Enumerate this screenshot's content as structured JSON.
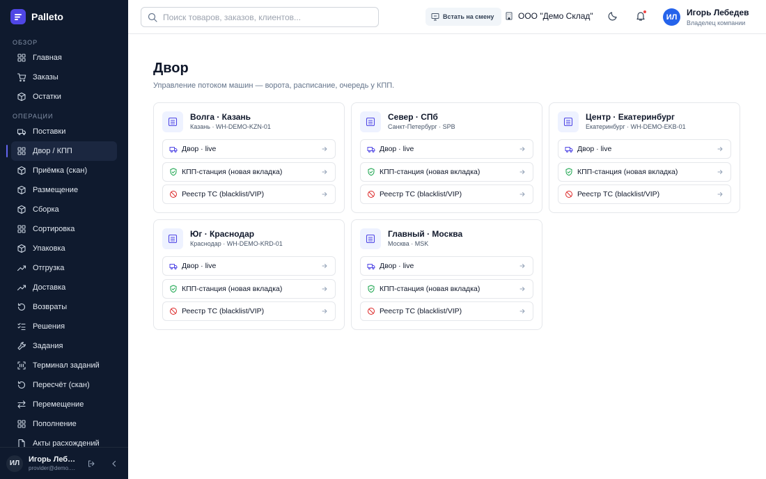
{
  "brand": {
    "name": "Palleto"
  },
  "sidebar": {
    "sections": [
      {
        "title": "ОБЗОР",
        "items": [
          {
            "label": "Главная",
            "icon": "grid-icon"
          },
          {
            "label": "Заказы",
            "icon": "cart-icon"
          },
          {
            "label": "Остатки",
            "icon": "box-icon"
          }
        ]
      },
      {
        "title": "ОПЕРАЦИИ",
        "items": [
          {
            "label": "Поставки",
            "icon": "truck-icon"
          },
          {
            "label": "Двор / КПП",
            "icon": "grid-icon",
            "active": true
          },
          {
            "label": "Приёмка (скан)",
            "icon": "box-icon"
          },
          {
            "label": "Размещение",
            "icon": "box-icon"
          },
          {
            "label": "Сборка",
            "icon": "box-icon"
          },
          {
            "label": "Сортировка",
            "icon": "grid-icon"
          },
          {
            "label": "Упаковка",
            "icon": "box-icon"
          },
          {
            "label": "Отгрузка",
            "icon": "trend-icon"
          },
          {
            "label": "Доставка",
            "icon": "trend-icon"
          },
          {
            "label": "Возвраты",
            "icon": "rotate-icon"
          },
          {
            "label": "Решения",
            "icon": "list-check-icon"
          },
          {
            "label": "Задания",
            "icon": "wrench-icon"
          },
          {
            "label": "Терминал заданий",
            "icon": "scan-icon"
          },
          {
            "label": "Пересчёт (скан)",
            "icon": "rotate-icon"
          },
          {
            "label": "Перемещение",
            "icon": "swap-icon"
          },
          {
            "label": "Пополнение",
            "icon": "grid-icon"
          },
          {
            "label": "Акты расхождений",
            "icon": "file-icon"
          }
        ]
      }
    ],
    "footer": {
      "initials": "ИЛ",
      "name": "Игорь Лебедев",
      "email": "provider@demo.palleto.ru"
    }
  },
  "header": {
    "search_placeholder": "Поиск товаров, заказов, клиентов...",
    "shift_button": "Встать на смену",
    "company": "ООО \"Демо Склад\"",
    "user": {
      "initials": "ИЛ",
      "name": "Игорь Лебедев",
      "role": "Владелец компании"
    },
    "has_notifications": true
  },
  "page": {
    "title": "Двор",
    "subtitle": "Управление потоком машин — ворота, расписание, очередь у КПП."
  },
  "yards": [
    {
      "title": "Волга · Казань",
      "sub": "Казань · WH-DEMO-KZN-01",
      "links": [
        "Двор · live",
        "КПП-станция (новая вкладка)",
        "Реестр ТС (blacklist/VIP)"
      ]
    },
    {
      "title": "Север · СПб",
      "sub": "Санкт-Петербург · SPB",
      "links": [
        "Двор · live",
        "КПП-станция (новая вкладка)",
        "Реестр ТС (blacklist/VIP)"
      ]
    },
    {
      "title": "Центр · Екатеринбург",
      "sub": "Екатеринбург · WH-DEMO-EKB-01",
      "links": [
        "Двор · live",
        "КПП-станция (новая вкладка)",
        "Реестр ТС (blacklist/VIP)"
      ]
    },
    {
      "title": "Юг · Краснодар",
      "sub": "Краснодар · WH-DEMO-KRD-01",
      "links": [
        "Двор · live",
        "КПП-станция (новая вкладка)",
        "Реестр ТС (blacklist/VIP)"
      ]
    },
    {
      "title": "Главный · Москва",
      "sub": "Москва · MSK",
      "links": [
        "Двор · live",
        "КПП-станция (новая вкладка)",
        "Реестр ТС (blacklist/VIP)"
      ]
    }
  ],
  "colors": {
    "sidebar_bg": "#0f1a2e",
    "accent": "#6366f1",
    "avatar": "#2563eb",
    "notification": "#ef4444"
  }
}
